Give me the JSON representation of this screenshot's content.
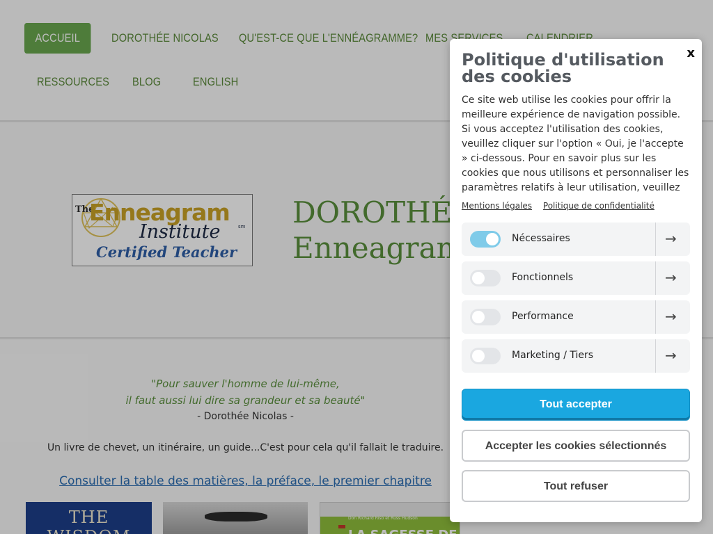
{
  "nav": {
    "items": [
      {
        "label": "ACCUEIL",
        "active": true
      },
      {
        "label": "DOROTHÉE NICOLAS"
      },
      {
        "label": "QU'EST-CE QUE L'ENNÉAGRAMME?"
      },
      {
        "label": "MES SERVICES"
      },
      {
        "label": "CALENDRIER"
      },
      {
        "label": "RESSOURCES"
      },
      {
        "label": "BLOG"
      },
      {
        "label": "ENGLISH"
      }
    ]
  },
  "hero": {
    "logo": {
      "the": "The",
      "enneagram": "Enneagram",
      "institute": "Institute",
      "sm": "sm",
      "certified": "Certified Teacher"
    },
    "title_line1": "DOROTHÉE",
    "title_line2": "Enneagram"
  },
  "content": {
    "quote_line1": "\"Pour sauver l'homme de lui-même,",
    "quote_line2": "il faut aussi lui dire sa grandeur et sa beauté\"",
    "author": "- Dorothée Nicolas -",
    "lead": "Un livre de chevet, un itinéraire, un guide...C'est pour cela qu'il fallait le traduire.",
    "link": "Consulter la table des matières, la préface, le premier chapitre",
    "books": {
      "book1_text": "THE WISDOM",
      "book3_small": "Don Richard Riso et Russ Hudson",
      "book3_big": "LA SAGESSE DE"
    }
  },
  "cookie": {
    "close_label": "x",
    "title": "Politique d'utilisation des cookies",
    "text": "Ce site web utilise les cookies pour offrir la meilleure expérience de navigation possible. Si vous acceptez l'utilisation des cookies, veuillez cliquer sur l'option « Oui, je l'accepte » ci-dessous. Pour en savoir plus sur les cookies que nous utilisons et personnaliser les paramètres relatifs à leur utilisation, veuillez",
    "links": {
      "legal": "Mentions légales",
      "privacy": "Politique de confidentialité"
    },
    "categories": [
      {
        "label": "Nécessaires",
        "enabled": true
      },
      {
        "label": "Fonctionnels",
        "enabled": false
      },
      {
        "label": "Performance",
        "enabled": false
      },
      {
        "label": "Marketing / Tiers",
        "enabled": false
      }
    ],
    "arrow": "→",
    "buttons": {
      "accept_all": "Tout accepter",
      "accept_selected": "Accepter les cookies sélectionnés",
      "refuse_all": "Tout refuser"
    }
  },
  "colors": {
    "accent_green": "#6aa84f",
    "title_green": "#5a8f3c",
    "primary_blue": "#1aa7e0",
    "toggle_on": "#7fcbe9"
  }
}
